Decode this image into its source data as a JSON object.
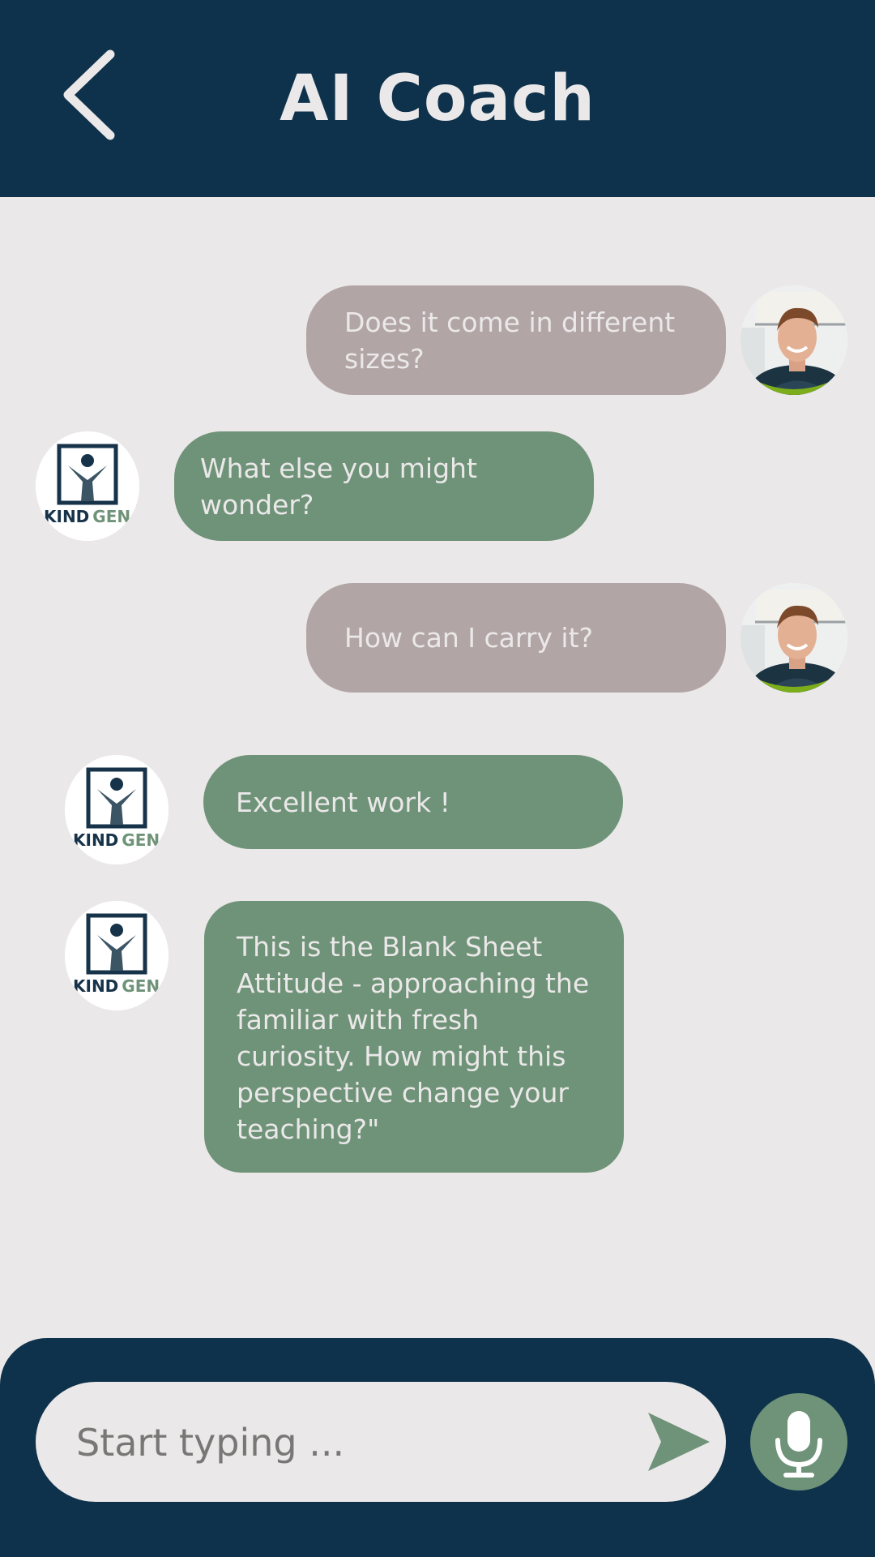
{
  "header": {
    "title": "AI Coach",
    "back_icon": "chevron-left-icon"
  },
  "colors": {
    "header_bg": "#0e324b",
    "page_bg": "#ebe8e9",
    "user_bubble": "#b2a5a5",
    "ai_bubble": "#6f9378",
    "accent_green": "#6f9378"
  },
  "messages": [
    {
      "sender": "user",
      "text": "Does it come in different sizes?"
    },
    {
      "sender": "ai",
      "text": "What else you might wonder?"
    },
    {
      "sender": "user",
      "text": "How can I carry it?"
    },
    {
      "sender": "ai",
      "text": "Excellent work !"
    },
    {
      "sender": "ai",
      "text": "This is the Blank Sheet Attitude - approaching the familiar with fresh curiosity. How might this perspective change your teaching?\""
    }
  ],
  "logo": {
    "word1": "KIND",
    "word2": "GEN"
  },
  "composer": {
    "placeholder": "Start typing ...",
    "send_icon": "send-icon",
    "mic_icon": "microphone-icon"
  }
}
